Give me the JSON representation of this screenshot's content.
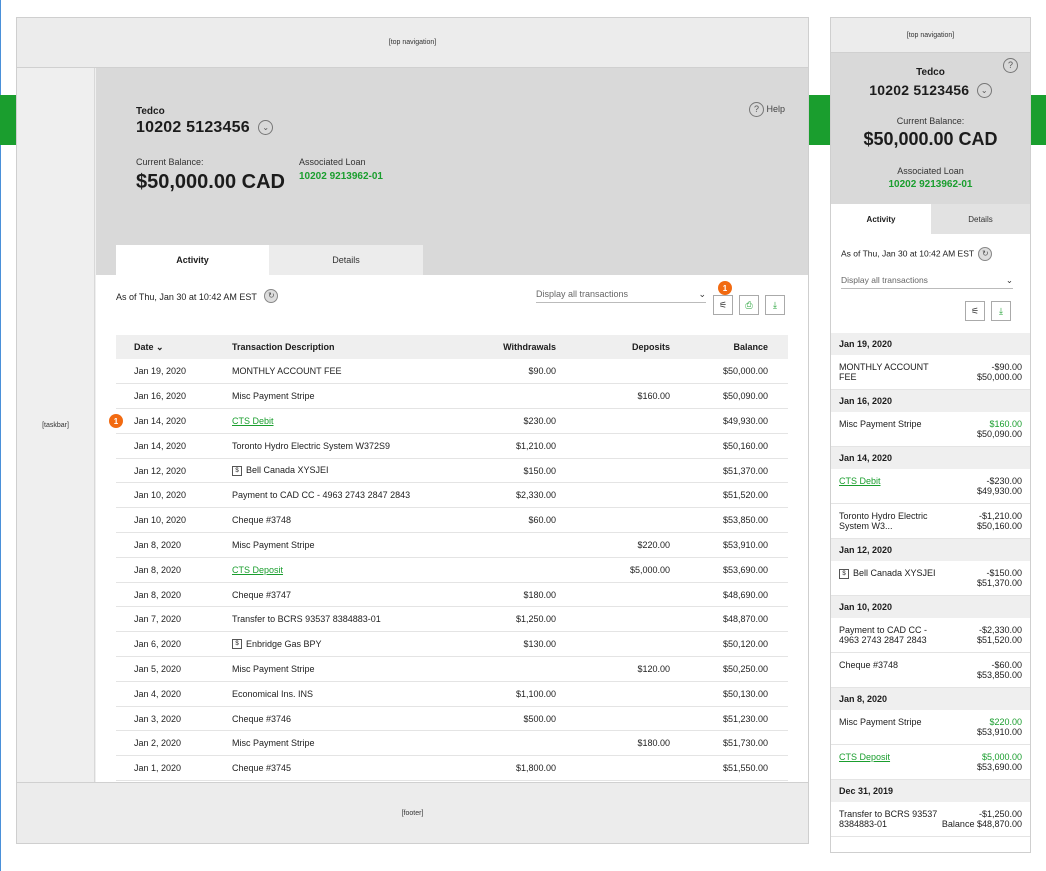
{
  "nav": {
    "top": "[top navigation]",
    "taskbar": "[taskbar]",
    "footer": "[footer]"
  },
  "account": {
    "name": "Tedco",
    "number": "10202 5123456",
    "balance_label": "Current Balance:",
    "balance": "$50,000.00 CAD",
    "loan_label": "Associated Loan",
    "loan_number": "10202 9213962-01",
    "help": "Help"
  },
  "tabs": [
    "Activity",
    "Details"
  ],
  "toolbar": {
    "as_of": "As of Thu, Jan 30 at 10:42 AM EST",
    "filter": "Display all transactions",
    "badge": "1"
  },
  "table": {
    "headers": [
      "Date",
      "Transaction Description",
      "Withdrawals",
      "Deposits",
      "Balance"
    ],
    "row_badge": "1",
    "rows": [
      {
        "date": "Jan 19, 2020",
        "desc": "MONTHLY ACCOUNT FEE",
        "wd": "$90.00",
        "dep": "",
        "bal": "$50,000.00"
      },
      {
        "date": "Jan 16, 2020",
        "desc": "Misc Payment Stripe",
        "wd": "",
        "dep": "$160.00",
        "bal": "$50,090.00"
      },
      {
        "date": "Jan 14, 2020",
        "desc": "CTS Debit",
        "wd": "$230.00",
        "dep": "",
        "bal": "$49,930.00",
        "link": true
      },
      {
        "date": "Jan 14, 2020",
        "desc": "Toronto Hydro Electric System W372S9",
        "wd": "$1,210.00",
        "dep": "",
        "bal": "$50,160.00"
      },
      {
        "date": "Jan 12, 2020",
        "desc": "Bell Canada XYSJEI",
        "wd": "$150.00",
        "dep": "",
        "bal": "$51,370.00",
        "bill": true
      },
      {
        "date": "Jan 10, 2020",
        "desc": "Payment to CAD CC - 4963 2743 2847 2843",
        "wd": "$2,330.00",
        "dep": "",
        "bal": "$51,520.00"
      },
      {
        "date": "Jan 10, 2020",
        "desc": "Cheque #3748",
        "wd": "$60.00",
        "dep": "",
        "bal": "$53,850.00"
      },
      {
        "date": "Jan 8, 2020",
        "desc": "Misc Payment Stripe",
        "wd": "",
        "dep": "$220.00",
        "bal": "$53,910.00"
      },
      {
        "date": "Jan 8, 2020",
        "desc": "CTS Deposit",
        "wd": "",
        "dep": "$5,000.00",
        "bal": "$53,690.00",
        "link": true
      },
      {
        "date": "Jan 8, 2020",
        "desc": "Cheque #3747",
        "wd": "$180.00",
        "dep": "",
        "bal": "$48,690.00"
      },
      {
        "date": "Jan 7, 2020",
        "desc": "Transfer to BCRS 93537 8384883-01",
        "wd": "$1,250.00",
        "dep": "",
        "bal": "$48,870.00"
      },
      {
        "date": "Jan 6, 2020",
        "desc": "Enbridge Gas BPY",
        "wd": "$130.00",
        "dep": "",
        "bal": "$50,120.00",
        "bill": true
      },
      {
        "date": "Jan 5, 2020",
        "desc": "Misc Payment Stripe",
        "wd": "",
        "dep": "$120.00",
        "bal": "$50,250.00"
      },
      {
        "date": "Jan 4, 2020",
        "desc": "Economical Ins. INS",
        "wd": "$1,100.00",
        "dep": "",
        "bal": "$50,130.00"
      },
      {
        "date": "Jan 3, 2020",
        "desc": "Cheque #3746",
        "wd": "$500.00",
        "dep": "",
        "bal": "$51,230.00"
      },
      {
        "date": "Jan 2, 2020",
        "desc": "Misc Payment Stripe",
        "wd": "",
        "dep": "$180.00",
        "bal": "$51,730.00"
      },
      {
        "date": "Jan 1, 2020",
        "desc": "Cheque #3745",
        "wd": "$1,800.00",
        "dep": "",
        "bal": "$51,550.00"
      }
    ]
  },
  "mobile": {
    "as_of": "As of Thu, Jan 30 at 10:42 AM EST",
    "filter": "Display all transactions",
    "groups": [
      {
        "date": "Jan 19, 2020",
        "items": [
          {
            "desc": "MONTHLY ACCOUNT FEE",
            "amt": "-$90.00",
            "bal": "$50,000.00"
          }
        ]
      },
      {
        "date": "Jan 16, 2020",
        "items": [
          {
            "desc": "Misc Payment Stripe",
            "amt": "$160.00",
            "bal": "$50,090.00",
            "pos": true
          }
        ]
      },
      {
        "date": "Jan 14, 2020",
        "items": [
          {
            "desc": "CTS Debit",
            "amt": "-$230.00",
            "bal": "$49,930.00",
            "link": true
          },
          {
            "desc": "Toronto Hydro Electric System W3...",
            "amt": "-$1,210.00",
            "bal": "$50,160.00"
          }
        ]
      },
      {
        "date": "Jan 12, 2020",
        "items": [
          {
            "desc": "Bell Canada XYSJEI",
            "amt": "-$150.00",
            "bal": "$51,370.00",
            "bill": true
          }
        ]
      },
      {
        "date": "Jan 10, 2020",
        "items": [
          {
            "desc": "Payment to CAD CC - 4963 2743 2847 2843",
            "amt": "-$2,330.00",
            "bal": "$51,520.00"
          },
          {
            "desc": "Cheque #3748",
            "amt": "-$60.00",
            "bal": "$53,850.00"
          }
        ]
      },
      {
        "date": "Jan 8, 2020",
        "items": [
          {
            "desc": "Misc Payment Stripe",
            "amt": "$220.00",
            "bal": "$53,910.00",
            "pos": true
          },
          {
            "desc": "CTS Deposit",
            "amt": "$5,000.00",
            "bal": "$53,690.00",
            "pos": true,
            "link": true
          }
        ]
      },
      {
        "date": "Dec 31, 2019",
        "items": [
          {
            "desc": "Transfer to BCRS 93537 8384883-01",
            "amt": "-$1,250.00",
            "bal": "Balance $48,870.00"
          }
        ]
      }
    ]
  }
}
